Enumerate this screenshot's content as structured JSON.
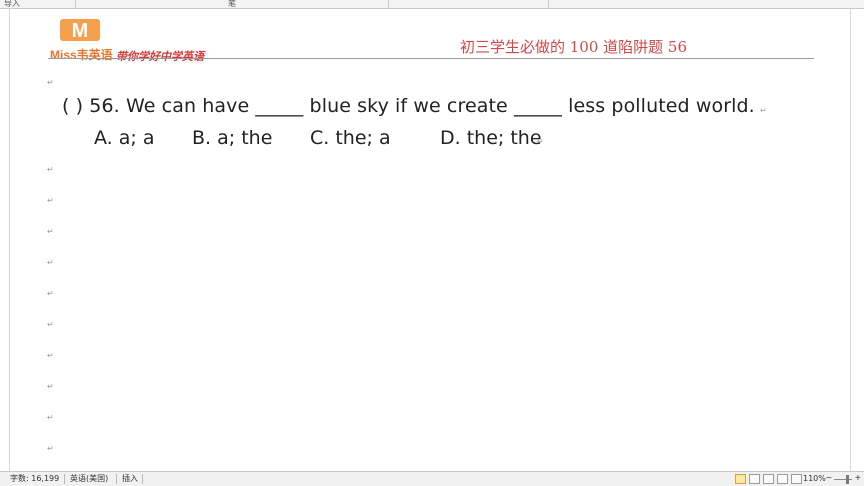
{
  "top_bar": {
    "left_text": "导入",
    "right_text": "笔"
  },
  "header": {
    "logo_letter": "M",
    "brand_name": "Miss韦英语",
    "slogan": "带你学好中学英语",
    "title": "初三学生必做的 100 道陷阱题   56",
    "brand_color": "#e8772e",
    "title_color": "#d04848"
  },
  "question": {
    "text": "(     ) 56. We can have _____ blue sky if we create _____ less polluted world.",
    "options": [
      "A. a; a",
      "B. a; the",
      "C. the; a",
      "D. the; the"
    ]
  },
  "paragraph_mark": "↵",
  "status_bar": {
    "word_count": "字数: 16,199",
    "language": "英语(美国)",
    "mode": "插入",
    "zoom": "110%",
    "zoom_minus": "−",
    "zoom_plus": "+"
  }
}
